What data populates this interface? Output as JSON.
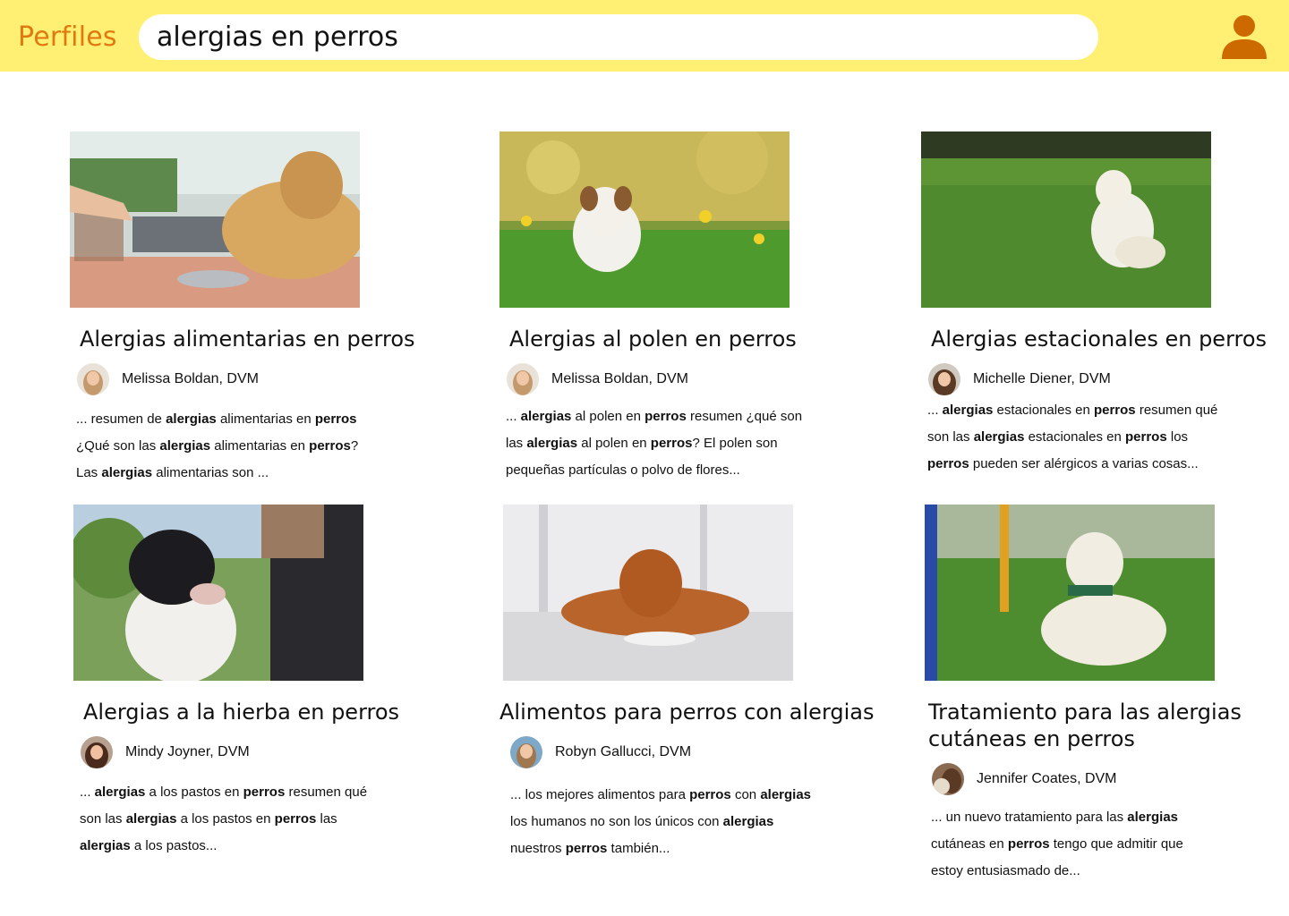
{
  "header": {
    "brand": "Perfiles",
    "search_value": "alergias en perros",
    "profile_icon": "user-icon",
    "colors": {
      "bar": "#fff074",
      "brand": "#e07a10",
      "icon": "#cc6a00"
    }
  },
  "results": [
    {
      "title": "Alergias alimentarias en perros",
      "author": "Melissa Boldan, DVM",
      "snippet": "... resumen de **alergias** alimentarias en **perros** ¿Qué son las **alergias** alimentarias en **perros**? Las **alergias** alimentarias son ...",
      "image": "golden dog watching kibble poured into bowl"
    },
    {
      "title": "Alergias al polen en perros",
      "author": "Melissa Boldan, DVM",
      "snippet": "... **alergias** al polen en **perros** resumen ¿qué son las **alergias** al polen en **perros**? El polen son pequeñas partículas o polvo de flores...",
      "image": "terrier in dandelion field"
    },
    {
      "title": "Alergias estacionales en perros",
      "author": "Michelle Diener, DVM",
      "snippet": "... **alergias** estacionales en **perros** resumen qué son las **alergias** estacionales en **perros** los **perros** pueden ser alérgicos a varias cosas...",
      "image": "white labrador scratching on grass"
    },
    {
      "title": "Alergias a la hierba en perros",
      "author": "Mindy Joyner, DVM",
      "snippet": "... **alergias** a los pastos en **perros** resumen qué son las **alergias** a los pastos en **perros** las **alergias** a los pastos...",
      "image": "black and white dog on leash"
    },
    {
      "title": "Alimentos para perros con alergias",
      "author": "Robyn Gallucci, DVM",
      "snippet": "... los mejores alimentos para **perros** con **alergias** los humanos no son los únicos con **alergias** nuestros **perros** también...",
      "image": "golden retriever eating from plate"
    },
    {
      "title": "Tratamiento para las alergias cutáneas en perros",
      "author": "Jennifer Coates, DVM",
      "snippet": "... un nuevo tratamiento para las **alergias** cutáneas en **perros** tengo que admitir que estoy entusiasmado de...",
      "image": "labrador puppy scratching in park"
    }
  ]
}
